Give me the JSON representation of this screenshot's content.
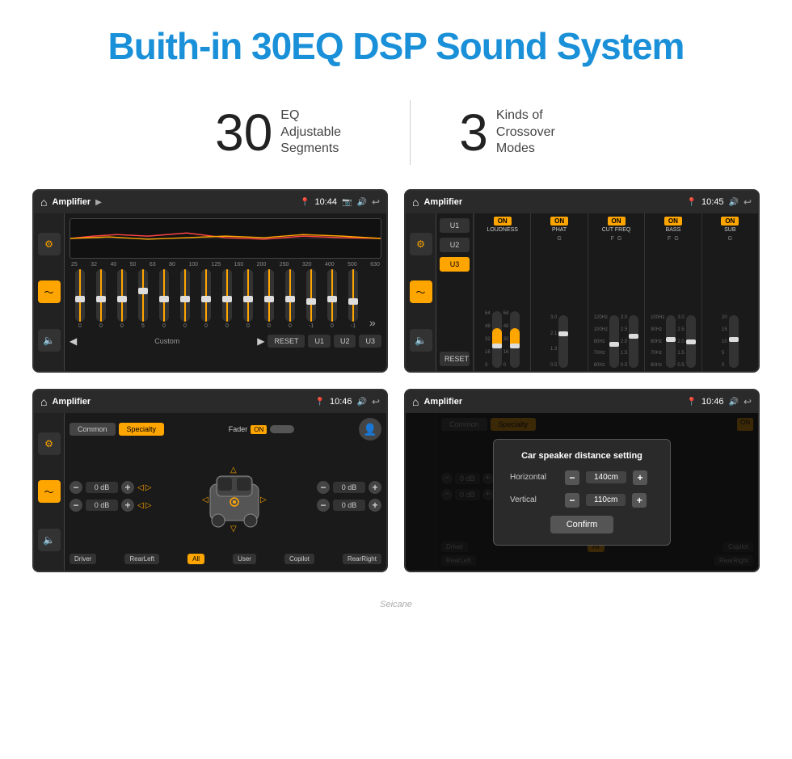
{
  "header": {
    "title": "Buith-in 30EQ DSP Sound System"
  },
  "stats": {
    "eq_number": "30",
    "eq_label_line1": "EQ Adjustable",
    "eq_label_line2": "Segments",
    "crossover_number": "3",
    "crossover_label_line1": "Kinds of",
    "crossover_label_line2": "Crossover Modes"
  },
  "screen1": {
    "title": "Amplifier",
    "time": "10:44",
    "freq_labels": [
      "25",
      "32",
      "40",
      "50",
      "63",
      "80",
      "100",
      "125",
      "160",
      "200",
      "250",
      "320",
      "400",
      "500",
      "630"
    ],
    "slider_values": [
      "0",
      "0",
      "0",
      "0",
      "5",
      "0",
      "0",
      "0",
      "0",
      "0",
      "0",
      "0",
      "0",
      "-1",
      "0",
      "-1"
    ],
    "bottom_btns": [
      "RESET",
      "U1",
      "U2",
      "U3"
    ],
    "preset_label": "Custom"
  },
  "screen2": {
    "title": "Amplifier",
    "time": "10:45",
    "presets": [
      "U1",
      "U2",
      "U3"
    ],
    "active_preset": "U3",
    "channels": [
      "LOUDNESS",
      "PHAT",
      "CUT FREQ",
      "BASS",
      "SUB"
    ],
    "channel_on": [
      true,
      true,
      true,
      true,
      true
    ],
    "reset_label": "RESET"
  },
  "screen3": {
    "title": "Amplifier",
    "time": "10:46",
    "tabs": [
      "Common",
      "Specialty"
    ],
    "active_tab": "Specialty",
    "fader_label": "Fader",
    "fader_on": "ON",
    "vol_rows": [
      {
        "label": "0 dB"
      },
      {
        "label": "0 dB"
      },
      {
        "label": "0 dB"
      },
      {
        "label": "0 dB"
      }
    ],
    "bottom_btns": [
      "Driver",
      "RearLeft",
      "All",
      "User",
      "Copilot",
      "RearRight"
    ],
    "active_bottom": "All"
  },
  "screen4": {
    "title": "Amplifier",
    "time": "10:46",
    "dialog": {
      "title": "Car speaker distance setting",
      "horizontal_label": "Horizontal",
      "horizontal_value": "140cm",
      "vertical_label": "Vertical",
      "vertical_value": "110cm",
      "confirm_label": "Confirm"
    }
  },
  "watermark": "Seicane"
}
